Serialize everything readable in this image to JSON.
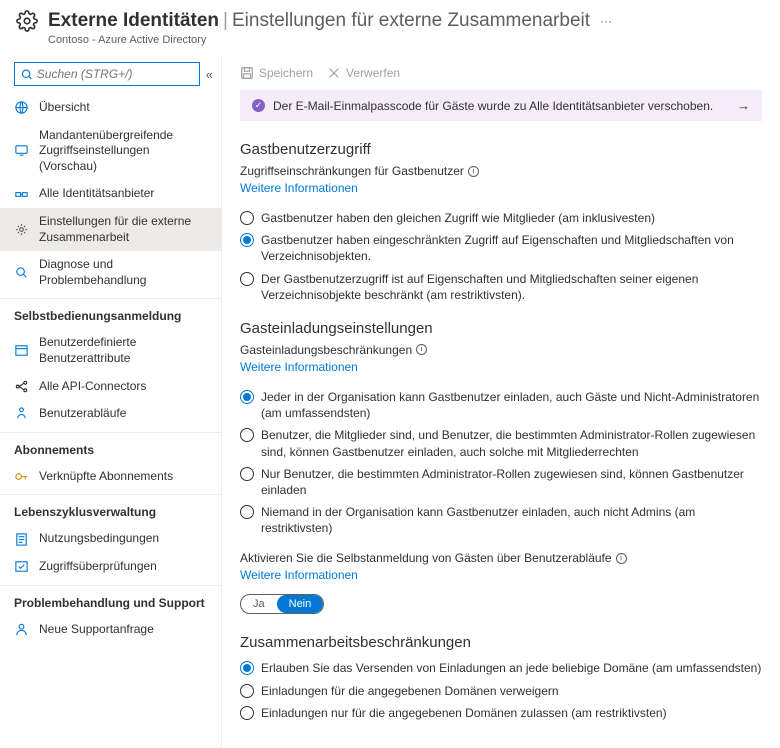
{
  "header": {
    "title": "Externe Identitäten",
    "subtitle": "Einstellungen für externe Zusammenarbeit",
    "breadcrumb": "Contoso - Azure Active Directory"
  },
  "search": {
    "placeholder": "Suchen (STRG+/)"
  },
  "nav": {
    "items_top": [
      {
        "label": "Übersicht",
        "icon": "globe"
      },
      {
        "label": "Mandantenübergreifende Zugriffseinstellungen (Vorschau)",
        "icon": "screen"
      },
      {
        "label": "Alle Identitätsanbieter",
        "icon": "connect"
      },
      {
        "label": "Einstellungen für die externe Zusammenarbeit",
        "icon": "gear"
      },
      {
        "label": "Diagnose und Problembehandlung",
        "icon": "diagnose"
      }
    ],
    "section1": {
      "title": "Selbstbedienungsanmeldung",
      "items": [
        {
          "label": "Benutzerdefinierte Benutzerattribute",
          "icon": "attrs"
        },
        {
          "label": "Alle API-Connectors",
          "icon": "api"
        },
        {
          "label": "Benutzerabläufe",
          "icon": "flow"
        }
      ]
    },
    "section2": {
      "title": "Abonnements",
      "items": [
        {
          "label": "Verknüpfte Abonnements",
          "icon": "key"
        }
      ]
    },
    "section3": {
      "title": "Lebenszyklusverwaltung",
      "items": [
        {
          "label": "Nutzungsbedingungen",
          "icon": "terms"
        },
        {
          "label": "Zugriffsüberprüfungen",
          "icon": "reviews"
        }
      ]
    },
    "section4": {
      "title": "Problembehandlung und Support",
      "items": [
        {
          "label": "Neue Supportanfrage",
          "icon": "support"
        }
      ]
    }
  },
  "toolbar": {
    "save": "Speichern",
    "discard": "Verwerfen"
  },
  "banner": {
    "text": "Der E-Mail-Einmalpasscode für Gäste wurde zu Alle Identitätsanbieter verschoben."
  },
  "sections": {
    "guest_access": {
      "title": "Gastbenutzerzugriff",
      "label": "Zugriffseinschränkungen für Gastbenutzer",
      "link": "Weitere Informationen",
      "options": [
        "Gastbenutzer haben den gleichen Zugriff wie Mitglieder (am inklusivesten)",
        "Gastbenutzer haben eingeschränkten Zugriff auf Eigenschaften und Mitgliedschaften von Verzeichnisobjekten.",
        "Der Gastbenutzerzugriff ist auf Eigenschaften und Mitgliedschaften seiner eigenen Verzeichnisobjekte beschränkt (am restriktivsten)."
      ],
      "selected": 1
    },
    "invite": {
      "title": "Gasteinladungseinstellungen",
      "label": "Gasteinladungsbeschränkungen",
      "link": "Weitere Informationen",
      "options": [
        "Jeder in der Organisation kann Gastbenutzer einladen, auch Gäste und Nicht-Administratoren (am umfassendsten)",
        "Benutzer, die Mitglieder sind, und Benutzer, die bestimmten Administrator-Rollen zugewiesen sind, können Gastbenutzer einladen, auch solche mit Mitgliederrechten",
        "Nur Benutzer, die bestimmten Administrator-Rollen zugewiesen sind, können Gastbenutzer einladen",
        "Niemand in der Organisation kann Gastbenutzer einladen, auch nicht Admins (am restriktivsten)"
      ],
      "selected": 0,
      "self_label": "Aktivieren Sie die Selbstanmeldung von Gästen über Benutzerabläufe",
      "self_link": "Weitere Informationen",
      "toggle_on": "Ja",
      "toggle_off": "Nein"
    },
    "collab": {
      "title": "Zusammenarbeitsbeschränkungen",
      "options": [
        "Erlauben Sie das Versenden von Einladungen an jede beliebige Domäne (am umfassendsten)",
        "Einladungen für die angegebenen Domänen verweigern",
        "Einladungen nur für die angegebenen Domänen zulassen (am restriktivsten)"
      ],
      "selected": 0
    }
  }
}
